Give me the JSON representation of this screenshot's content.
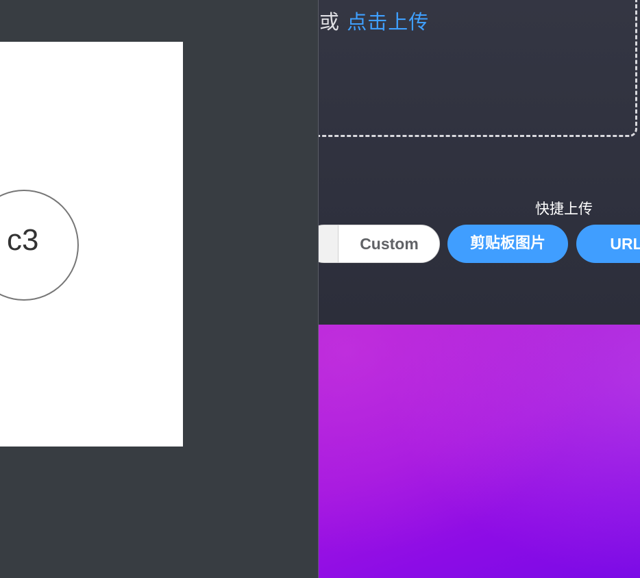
{
  "preview": {
    "node_label": "c3"
  },
  "upload": {
    "dropzone_text_prefix": "处，或 ",
    "dropzone_link": "点击上传"
  },
  "quick_upload": {
    "title": "快捷上传",
    "custom_label": "Custom",
    "clipboard_label": "剪贴板图片",
    "url_label": "URL"
  },
  "colors": {
    "accent": "#409eff",
    "pane_bg": "#383d42",
    "app_bg": "#2f313e",
    "wallpaper": "#a215e0"
  }
}
